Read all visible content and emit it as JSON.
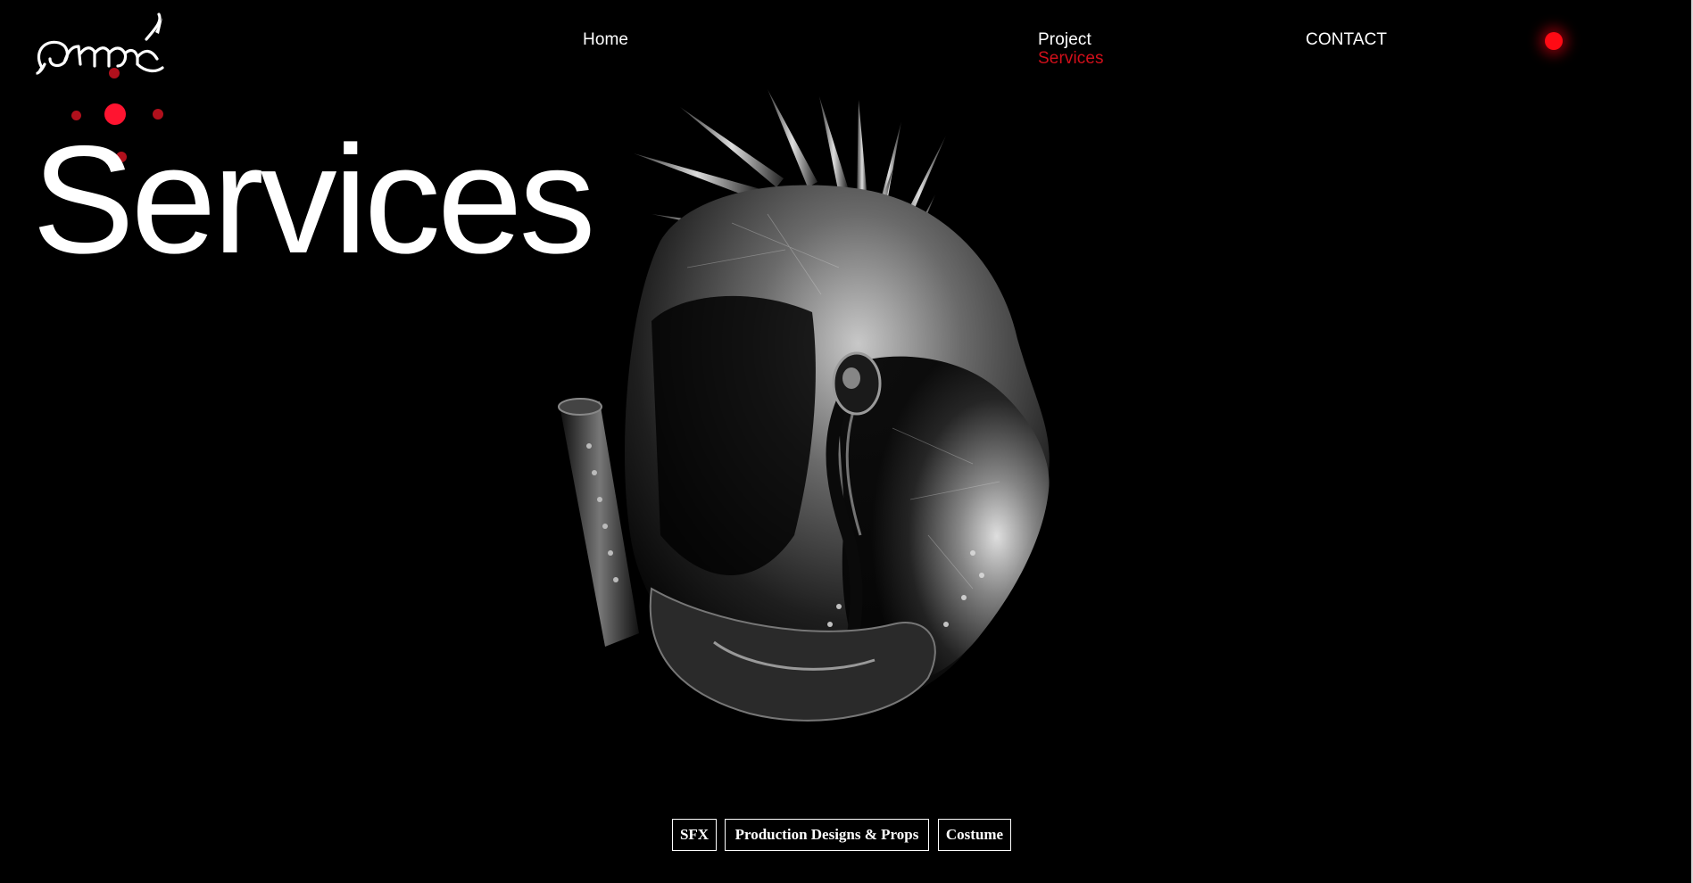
{
  "header": {
    "logo_text": "armor",
    "nav": {
      "home": "Home",
      "project": "Project",
      "services": "Services",
      "contact": "CONTACT"
    },
    "record_indicator": "red-dot-icon"
  },
  "main": {
    "title": "Services",
    "hero_image": "spiked-helmet-illustration"
  },
  "services": {
    "chips": [
      "SFX",
      "Production Designs & Props",
      "Costume"
    ]
  },
  "colors": {
    "background": "#000000",
    "accent_red": "#ff0a14",
    "active_link": "#d10f1a",
    "text": "#ffffff"
  }
}
